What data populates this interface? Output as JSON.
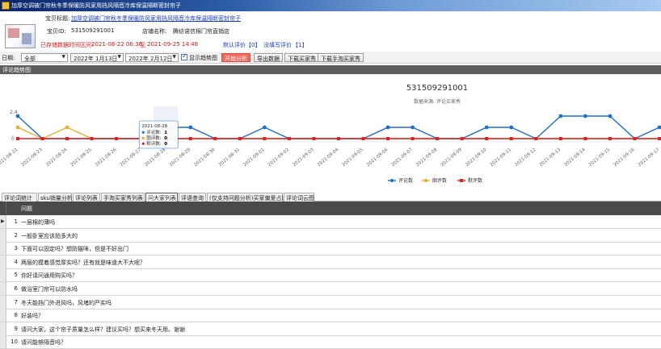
{
  "window": {
    "title": "加厚空调被门帘秋冬季保暖防风家用挡风隔音冷库保温隔断密封帘子"
  },
  "info": {
    "product_title_label": "宝贝标题:",
    "product_title": "加厚空调被门帘秋冬季保暖防风家用挡风隔音冷库保温隔断密封帘子",
    "product_id_label": "宝贝ID:",
    "product_id": "531509291001",
    "shop_label": "店铺名称:",
    "shop_name": "腾纺诺信棉门帘直销店",
    "range_label": "已存储数据时间区间:",
    "range_start": "2021-08-22 06:36",
    "range_sep": "至",
    "range_end": "2021-09-25 14:48",
    "default_review_label": "默认评价",
    "default_review_value": "【0】",
    "no_text_review_label": "没填写评价",
    "no_text_review_value": "【1】"
  },
  "toolbar": {
    "date_label": "日期:",
    "date_select": "全部",
    "date_from": "2022年 1月13日",
    "date_to": "2022年 2月12日",
    "show_trend_label": "显示趋势图",
    "btn_start": "开始分析",
    "btn_export": "导出数据",
    "btn_dl_buyer": "下载买家秀",
    "btn_dl_taobao": "下载手淘买家秀"
  },
  "section": {
    "trend_header": "评论趋势图"
  },
  "chart_data": {
    "type": "line",
    "title": "531509291001",
    "subtitle": "数据来源: 评论买家秀",
    "ytick": "2.4",
    "ytick0": "0",
    "categories": [
      "2021-08-22",
      "2021-08-23",
      "2021-08-24",
      "2021-08-25",
      "2021-08-26",
      "2021-08-27",
      "2021-08-28",
      "2021-08-29",
      "2021-08-30",
      "2021-08-31",
      "2021-09-01",
      "2021-09-02",
      "2021-09-03",
      "2021-09-04",
      "2021-09-05",
      "2021-09-06",
      "2021-09-07",
      "2021-09-08",
      "2021-09-09",
      "2021-09-10",
      "2021-09-11",
      "2021-09-12",
      "2021-09-13",
      "2021-09-14",
      "2021-09-15",
      "2021-09-16",
      "2021-09-17"
    ],
    "series": [
      {
        "name": "评论数",
        "color": "#1f6fd1",
        "values": [
          2,
          0,
          0,
          0,
          0,
          0,
          1,
          1,
          0,
          0,
          1,
          0,
          0,
          0,
          0,
          1,
          1,
          0,
          0,
          1,
          1,
          0,
          2,
          2,
          2,
          0,
          1
        ]
      },
      {
        "name": "图评数",
        "color": "#e8b030",
        "values": [
          1,
          0,
          1,
          0,
          0,
          0,
          0,
          0,
          0,
          0,
          0,
          0,
          0,
          0,
          0,
          0,
          0,
          0,
          0,
          0,
          0,
          0,
          0,
          0,
          0,
          0,
          0
        ]
      },
      {
        "name": "默评数",
        "color": "#e02020",
        "values": [
          0,
          0,
          0,
          0,
          0,
          0,
          0,
          0,
          0,
          0,
          0,
          0,
          0,
          0,
          0,
          0,
          0,
          0,
          0,
          0,
          0,
          0,
          0,
          0,
          0,
          0,
          0
        ]
      }
    ],
    "tooltip": {
      "date": "2021-08-28",
      "lines": [
        {
          "label": "评论数:",
          "value": "1",
          "color": "#1f6fd1"
        },
        {
          "label": "图评数:",
          "value": "0",
          "color": "#e8b030"
        },
        {
          "label": "默评数:",
          "value": "0",
          "color": "#e02020"
        }
      ]
    },
    "legend_position": "bottom"
  },
  "tabs": [
    {
      "label": "评论词统计",
      "active": false
    },
    {
      "label": "sku销量分析",
      "active": false
    },
    {
      "label": "评论列表",
      "active": false
    },
    {
      "label": "手淘买家秀列表",
      "active": false
    },
    {
      "label": "问大家列表",
      "active": true
    },
    {
      "label": "评语查询",
      "active": false
    },
    {
      "label": "(仅支持问题分析)买家偏爱占比",
      "active": false
    },
    {
      "label": "评论词云图",
      "active": false
    }
  ],
  "table": {
    "header": "问题",
    "rows": [
      {
        "num": "1",
        "text": "一层棉的薄吗"
      },
      {
        "num": "2",
        "text": "一般卧室应该拍多大的"
      },
      {
        "num": "3",
        "text": "下面可以固定吗？想防猫咪，但是不好出门"
      },
      {
        "num": "4",
        "text": "两层的摸着感觉厚实吗？还有就是味道大不大呢？"
      },
      {
        "num": "5",
        "text": "你好请问通用购买吗？"
      },
      {
        "num": "6",
        "text": "做浴室门帘可以防水吗"
      },
      {
        "num": "7",
        "text": "冬天能挡门外进风吗，风堵的严实吗"
      },
      {
        "num": "8",
        "text": "好装吗？"
      },
      {
        "num": "9",
        "text": "请问大家，这个帘子质量怎么样？建议买吗？想买来冬天用。谢谢"
      },
      {
        "num": "10",
        "text": "请问能够隔音吗？"
      }
    ]
  }
}
